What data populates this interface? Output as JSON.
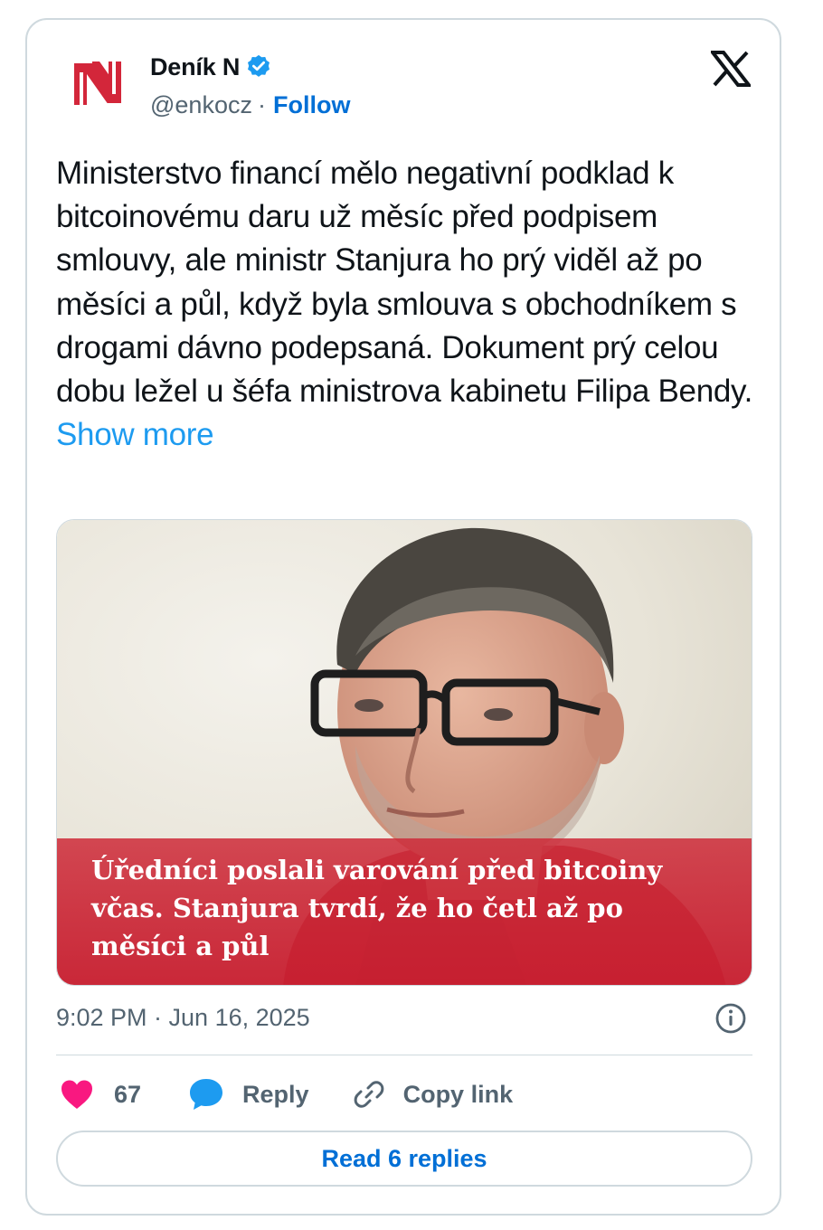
{
  "author": {
    "name": "Deník N",
    "handle": "@enkocz",
    "separator": "·",
    "follow_label": "Follow",
    "logo_letter": "N",
    "brand_color": "#d3263a",
    "verified": true
  },
  "tweet": {
    "text": "Ministerstvo financí mělo negativní podklad k bitcoinovému daru už měsíc před podpisem smlouvy, ale ministr Stanjura ho prý viděl až po měsíci a půl, když byla smlouva s obchodníkem s drogami dávno podepsaná. Dokument prý celou dobu ležel u šéfa ministrova kabinetu Filipa Bendy.",
    "show_more_label": "Show more"
  },
  "media": {
    "headline": "Úředníci poslali varování před bitcoiny včas. Stanjura tvrdí, že ho četl až po měsíci a půl"
  },
  "meta": {
    "timestamp": "9:02 PM · Jun 16, 2025"
  },
  "actions": {
    "likes": "67",
    "reply_label": "Reply",
    "copy_link_label": "Copy link"
  },
  "read_replies_label": "Read 6 replies",
  "icons": {
    "brand": "x-logo-icon",
    "verified": "verified-badge-icon",
    "info": "info-icon",
    "like": "heart-icon",
    "reply": "reply-bubble-icon",
    "copy": "link-icon"
  },
  "colors": {
    "link_blue": "#006fd6",
    "show_more_blue": "#1d9bf0",
    "heart_pink": "#f91880",
    "secondary_text": "#536471",
    "border": "#cfd9de"
  }
}
